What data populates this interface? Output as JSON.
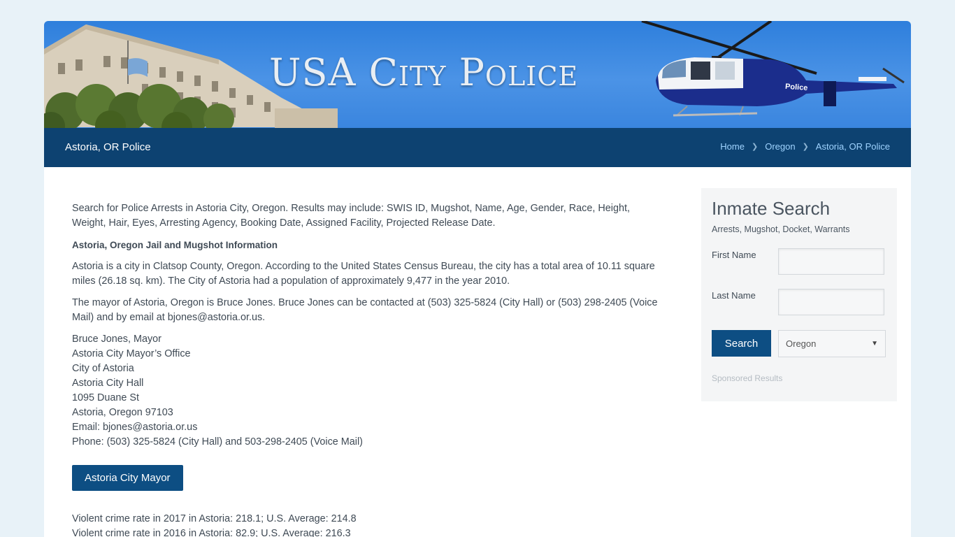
{
  "banner": {
    "title": "USA City Police",
    "helicopter_label": "Police"
  },
  "titlebar": {
    "page_title": "Astoria, OR Police",
    "breadcrumb": [
      {
        "label": "Home"
      },
      {
        "label": "Oregon"
      },
      {
        "label": "Astoria, OR Police"
      }
    ]
  },
  "main": {
    "intro": "Search for Police Arrests in Astoria City, Oregon. Results may include: SWIS ID, Mugshot, Name, Age, Gender, Race, Height, Weight, Hair, Eyes, Arresting Agency, Booking Date, Assigned Facility, Projected Release Date.",
    "heading": "Astoria, Oregon Jail and Mugshot Information",
    "para1": "Astoria is a city in Clatsop County, Oregon. According to the United States Census Bureau, the city has a total area of 10.11 square miles (26.18 sq. km). The City of Astoria had a population of approximately 9,477 in the year 2010.",
    "para2": "The mayor of Astoria, Oregon is Bruce Jones. Bruce Jones can be contacted at (503) 325-5824 (City Hall) or (503) 298-2405 (Voice Mail) and by email at bjones@astoria.or.us.",
    "address": [
      "Bruce Jones, Mayor",
      "Astoria City Mayor’s Office",
      "City of Astoria",
      "Astoria City Hall",
      "1095 Duane St",
      "Astoria, Oregon 97103",
      "Email: bjones@astoria.or.us",
      "Phone: (503) 325-5824 (City Hall) and 503-298-2405 (Voice Mail)"
    ],
    "mayor_button": "Astoria City Mayor",
    "stats": [
      "Violent crime rate in 2017 in Astoria: 218.1; U.S. Average: 214.8",
      "Violent crime rate in 2016 in Astoria: 82.9; U.S. Average: 216.3"
    ]
  },
  "sidebar": {
    "title": "Inmate Search",
    "subtitle": "Arrests, Mugshot, Docket, Warrants",
    "first_name_label": "First Name",
    "last_name_label": "Last Name",
    "search_button": "Search",
    "state_selected": "Oregon",
    "sponsored": "Sponsored Results"
  },
  "colors": {
    "page_bg": "#e8f2f8",
    "banner_blue": "#3a85de",
    "titlebar_navy": "#0d4271",
    "button_blue": "#0d4e83",
    "breadcrumb_link": "#9fd3ff"
  }
}
